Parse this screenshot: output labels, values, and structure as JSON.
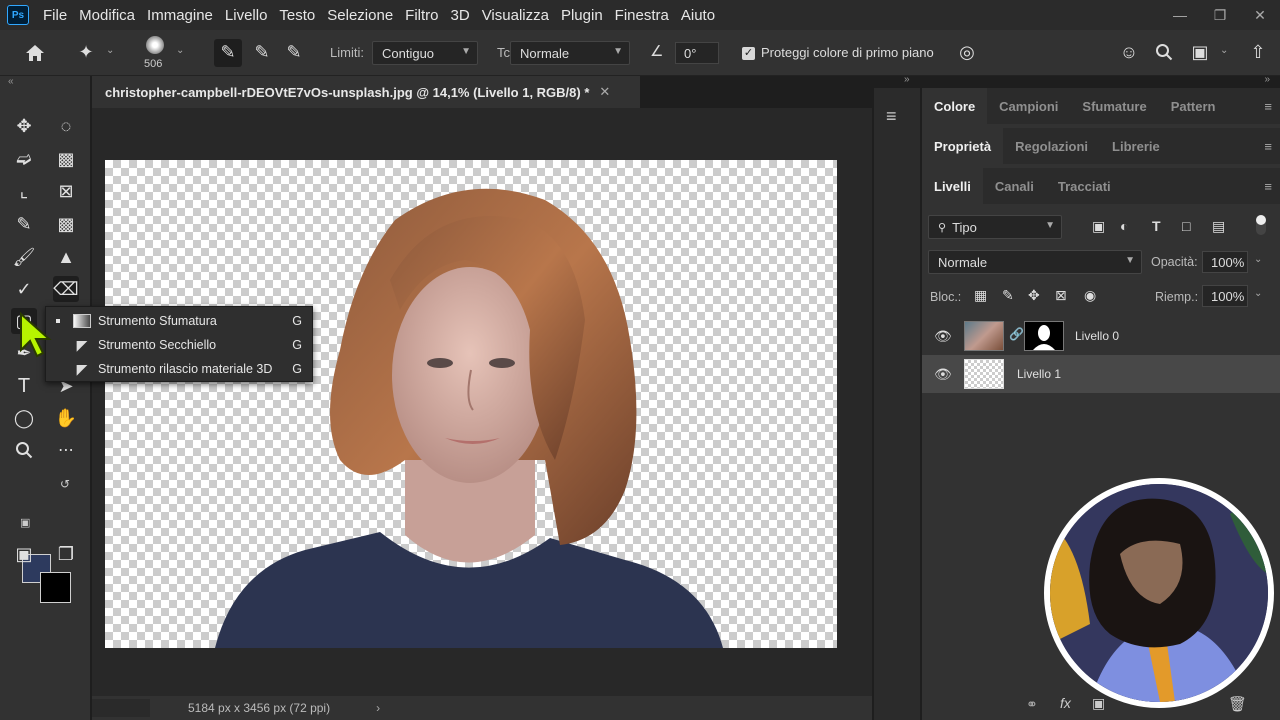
{
  "menubar": {
    "logo": "Ps",
    "items": [
      "File",
      "Modifica",
      "Immagine",
      "Livello",
      "Testo",
      "Selezione",
      "Filtro",
      "3D",
      "Visualizza",
      "Plugin",
      "Finestra",
      "Aiuto"
    ]
  },
  "options": {
    "brush_size": "506",
    "limits_label": "Limiti:",
    "limits_value": "Contiguo",
    "tolerance_label": "Tc",
    "mode_value": "Normale",
    "angle_value": "0°",
    "protect_label": "Proteggi colore di primo piano"
  },
  "document": {
    "tab_title": "christopher-campbell-rDEOVtE7vOs-unsplash.jpg @ 14,1% (Livello 1, RGB/8) *",
    "status_text": "5184 px x 3456 px (72 ppi)"
  },
  "flyout": {
    "items": [
      {
        "label": "Strumento Sfumatura",
        "key": "G"
      },
      {
        "label": "Strumento Secchiello",
        "key": "G"
      },
      {
        "label": "Strumento rilascio materiale 3D",
        "key": "G"
      }
    ]
  },
  "colors": {
    "foreground": "#2d3a5e",
    "background": "#000000",
    "cursor": "#b7f400"
  },
  "panels": {
    "tabs_top": [
      "Colore",
      "Campioni",
      "Sfumature",
      "Pattern"
    ],
    "tabs_mid": [
      "Proprietà",
      "Regolazioni",
      "Librerie"
    ],
    "tabs_layers": [
      "Livelli",
      "Canali",
      "Tracciati"
    ],
    "filter_value": "Tipo",
    "blend_mode": "Normale",
    "opacity_label": "Opacità:",
    "opacity_value": "100%",
    "lock_label": "Bloc.:",
    "fill_label": "Riemp.:",
    "fill_value": "100%",
    "layers": [
      {
        "name": "Livello 0"
      },
      {
        "name": "Livello 1"
      }
    ]
  }
}
